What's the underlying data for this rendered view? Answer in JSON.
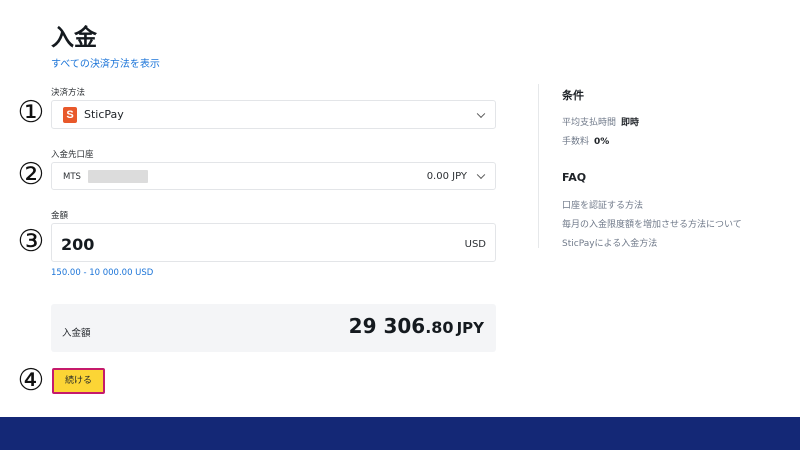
{
  "page": {
    "title": "入金",
    "show_all_methods_link": "すべての決済方法を表示"
  },
  "steps": [
    "①",
    "②",
    "③",
    "④"
  ],
  "payment_method": {
    "label": "決済方法",
    "logo_letter": "S",
    "selected": "SticPay",
    "logo_color": "#e8582a"
  },
  "deposit_account": {
    "label": "入金先口座",
    "prefix": "MTS",
    "balance": "0.00 JPY"
  },
  "amount": {
    "label": "金額",
    "value": "200",
    "currency": "USD",
    "range": "150.00 - 10 000.00 USD"
  },
  "summary": {
    "label": "入金額",
    "total_integer": "29 306",
    "total_decimal": ".80",
    "currency": "JPY"
  },
  "continue_button": {
    "label": "続ける",
    "bg_color": "#fcd535",
    "highlight_color": "#c51a6b"
  },
  "conditions": {
    "heading": "条件",
    "rows": [
      {
        "label": "平均支払時間",
        "value": "即時"
      },
      {
        "label": "手数料",
        "value": "0%"
      }
    ]
  },
  "faq": {
    "heading": "FAQ",
    "links": [
      "口座を認証する方法",
      "毎月の入金限度額を増加させる方法について",
      "SticPayによる入金方法"
    ]
  },
  "colors": {
    "link": "#1b74d8",
    "footer": "#142876"
  }
}
